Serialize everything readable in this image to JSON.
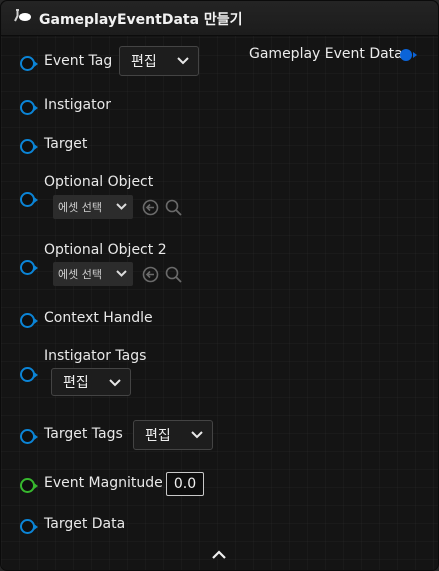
{
  "node": {
    "title": "GameplayEventData 만들기",
    "icon": "function-icon",
    "accent_blue": "#0b84d6",
    "accent_green": "#37b82e",
    "collapse_icon": "chevron-up-icon"
  },
  "output": {
    "label": "Gameplay Event Data"
  },
  "inputs": {
    "event_tag": {
      "label": "Event Tag",
      "button": "편집"
    },
    "instigator": {
      "label": "Instigator"
    },
    "target": {
      "label": "Target"
    },
    "optional_object": {
      "label": "Optional Object",
      "asset": "에셋 선택"
    },
    "optional_object_2": {
      "label": "Optional Object 2",
      "asset": "에셋 선택"
    },
    "context_handle": {
      "label": "Context Handle"
    },
    "instigator_tags": {
      "label": "Instigator Tags",
      "button": "편집"
    },
    "target_tags": {
      "label": "Target Tags",
      "button": "편집"
    },
    "event_magnitude": {
      "label": "Event Magnitude",
      "value": "0.0"
    },
    "target_data": {
      "label": "Target Data"
    }
  }
}
